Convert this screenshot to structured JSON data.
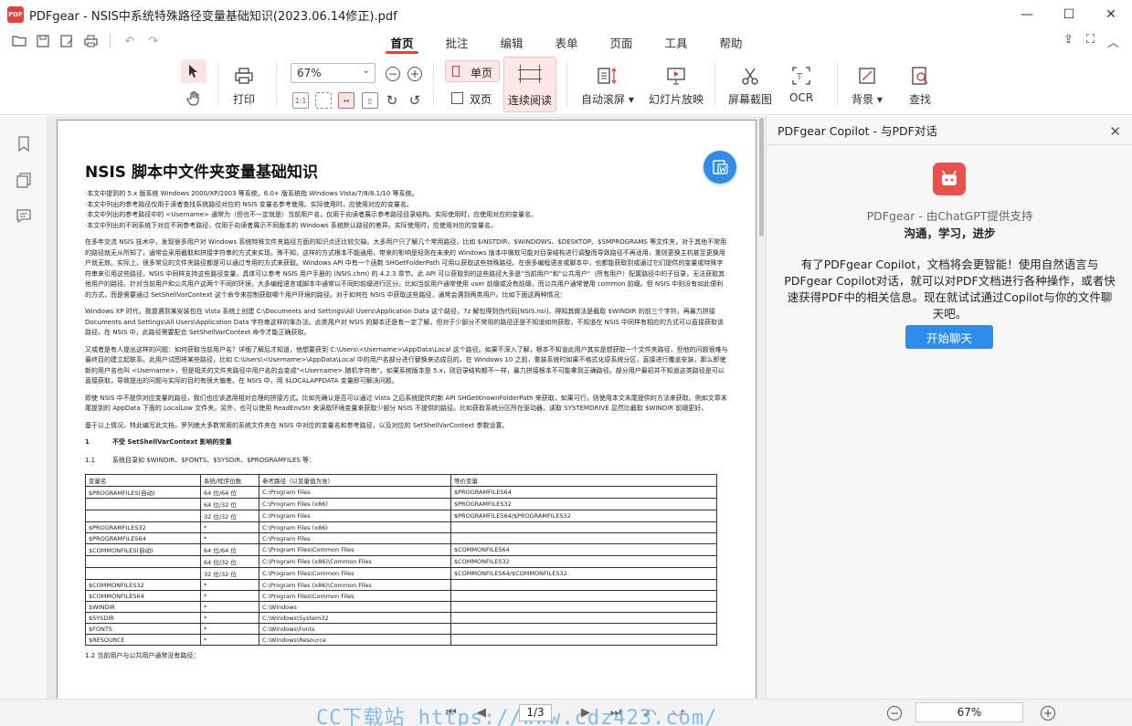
{
  "window": {
    "app_logo": "PDF",
    "title": "PDFgear - NSIS中系统特殊路径变量基础知识(2023.06.14修正).pdf",
    "minimize": "—",
    "maximize": "☐",
    "close": "✕"
  },
  "menu_tabs": [
    "首页",
    "批注",
    "编辑",
    "表单",
    "页面",
    "工具",
    "帮助"
  ],
  "ribbon": {
    "print": "打印",
    "zoom_value": "67%",
    "single_page": "单页",
    "double_page": "双页",
    "continuous": "连续阅读",
    "auto_scroll": "自动滚屏",
    "slideshow": "幻灯片放映",
    "screenshot": "屏幕截图",
    "ocr": "OCR",
    "background": "背景",
    "search": "查找",
    "small_icon_1": "1:1"
  },
  "document": {
    "title": "NSIS 脚本中文件夹变量基础知识",
    "bullets": [
      "·本文中提到的 5.x 版系统 Windows 2000/XP/2003 等系统，6.0+ 版系统指 Windows Vista/7/8/8.1/10 等系统。",
      "·本文中列出的参考路径仅用于读者查找系统路径对应的 NSIS 变量名参考使用。实际使用时，应使用对应的变量名。",
      "·本文中列出的参考路径中的 <Username> 通常为（但也不一定就是）当前用户名，仅用于向读者展示参考路径目录结构。实际使用时，应使用对应的变量名。",
      "·本文中列出的不同系统下对应不同参考路径，仅用于向读者展示不同版本的 Windows 系统默认路径的差异。实际使用时，应使用对应的变量名。"
    ],
    "paragraphs": [
      "在多年交流 NSIS 技术中，发现很多用户对 Windows 系统特殊文件夹路径方面的知识点还比较欠缺。大多用户只了解几个常用路径，比如 $INSTDIR、$WINDOWS、$DESKTOP、$SMPROGRAMS 等文件夹，对于其他不常用的路径就无从所知了，通常会采用截取和拼接字符串的方式来实现。殊不知，这样的方式根本不能通用，带来的影响是轻则在未来的 Windows 版本中微软可能对目录结构进行调整而导致路径不再适用，重则更换主机甚至更换用户就无效。实际上，很多常见的文件夹路径都是可以通过专用的方式来获取。Windows API 中有一个函数 SHGetFolderPath 可用以获取这些特殊路径。在很多编程语言或脚本中，也都能获取到或通过它们提供的变量或特殊字符串来引用这些路径，NSIS 中同样支持这些路径变量，具体可以参考 NSIS 用户手册的 (NSIS.chm) 的 4.2.3 章节。此 API 可以获取到的这些路径大多是\"当前用户\"和\"公共用户\"（所有用户）配置路径中的子目录，无法获取其他用户的路径。针对当前用户和公共用户这两个不同的环境，大多编程语言或脚本中通常以不同的前缀进行区分。比如当前用户通常使用 user 前缀或没有前缀，而公共用户通常使用 common 前缀。但 NSIS 中则没有如此便利的方式，而是需要通过 SetShellVarContext 这个命令来控制获取哪个用户环境的路径。对于如何在 NSIS 中获取这些路径，通常会遇到两类用户。比如下面这两种情况：",
      "Windows XP 时代，我曾遇到某安装包在 Vista 系统上创建 C:\\Documents and Settings\\All Users\\Application Data 这个路径，7z 解包得到伪代码[NSIS.nsi]，得知其做法是截取 $WINDIR 的前三个字符，再暴力拼接 Documents and Settings\\All Users\\Application Data 字符串这样的笨办法。此类用户对 NSIS 的脚本还是有一定了解，但对于少部分不常用的路径还是不知道如何获取，不知道在 NSIS 中同样有相应的方式可以直接获取该路径。在 NSIS 中，此路径需要配合 SetShellVarContext 命令才能正确获取。",
      "又或者是有人提出这样的问题：如何获取当前用户名？详细了解后才知道，他想要获到 C:\\Users\\<Username>\\AppData\\Local 这个路径。如果不深入了解，根本不知道此用户其实是想获取一个文件夹路径，但他的问题很难与最终目的建立起联系。此用户试图将某些路径，比如 C:\\Users\\<Username>\\AppData\\Local 中的用户名部分进行替换来达成目的。在 Windows 10 之前，重装系统时如果不格式化原系统分区，直接进行覆盖安装，那么即使新的用户名也叫 <Username>，但是相关的文件夹路径中用户名的会变成\"<Username>.随机字符串\"。如果系统版本是 5.x，则目录结构都不一样，暴力拼接根本不可能拿到正确路径。部分用户最初并不知道这类路径是可以直接获取，导致提出的问题与实际的目的有很大偏差。在 NSIS 中，用 $LOCALAPPDATA 变量即可解决问题。",
      "即使 NSIS 中不提供对应变量的路径，我们也应该选用相对合理的拼接方式。比如先确认是否可以通过 Vista 之后系统提供的新 API SHGetKnownFolderPath 来获取，如果可行，则使用本文末尾提供的方法来获取。例如文章末尾提到的 AppData 下面的 LocalLow 文件夹。另外，也可以使用 ReadEnvStr 来读取环境变量来获取少部分 NSIS 不提供的路径。比如获取系统分区所在驱动器，读取 SYSTEMDRIVE 显然比截取 $WINDIR 前缀更好。",
      "基于以上情况，特此编写此文档，罗列绝大多数常用的系统文件夹在 NSIS 中对应的变量名和参考路径，以及对应的 SetShellVarContext 参数设置。"
    ],
    "h1_num": "1",
    "h1": "不受 SetShellVarContext 影响的变量",
    "h2_num": "1.1",
    "h2": "系统目录如 $WINDIR、$FONTS、$SYSDIR、$PROGRAMFILES 等：",
    "table_header": [
      "变量名",
      "系统/程序位数",
      "参考路径（以变量值为准）",
      "等价变量"
    ],
    "table_rows": [
      [
        "$PROGRAMFILES(自动)",
        "64 位/64 位",
        "C:\\Program Files",
        "$PROGRAMFILES64"
      ],
      [
        "",
        "64 位/32 位",
        "C:\\Program Files (x86)",
        "$PROGRAMFILES32"
      ],
      [
        "",
        "32 位/32 位",
        "C:\\Program Files",
        "$PROGRAMFILES64/$PROGRAMFILES32"
      ],
      [
        "$PROGRAMFILES32",
        "*",
        "C:\\Program Files (x86)",
        ""
      ],
      [
        "$PROGRAMFILES64",
        "*",
        "C:\\Program Files",
        ""
      ],
      [
        "$COMMONFILES(自动)",
        "64 位/64 位",
        "C:\\Program Files\\Common Files",
        "$COMMONFILES64"
      ],
      [
        "",
        "64 位/32 位",
        "C:\\Program Files (x86)\\Common Files",
        "$COMMONFILES32"
      ],
      [
        "",
        "32 位/32 位",
        "C:\\Program Files\\Common Files",
        "$COMMONFILES64/$COMMONFILES32"
      ],
      [
        "$COMMONFILES32",
        "*",
        "C:\\Program Files (x86)\\Common Files",
        ""
      ],
      [
        "$COMMONFILES64",
        "*",
        "C:\\Program Files\\Common Files",
        ""
      ],
      [
        "$WINDIR",
        "*",
        "C:\\Windows",
        ""
      ],
      [
        "$SYSDIR",
        "*",
        "C:\\Windows\\System32",
        ""
      ],
      [
        "$FONTS",
        "*",
        "C:\\Windows\\Fonts",
        ""
      ],
      [
        "$RESOURCE",
        "*",
        "C:\\Windows\\Resource",
        ""
      ]
    ],
    "next_heading": "1.2    当前用户与公共用户通常没有路径："
  },
  "copilot": {
    "header": "PDFgear Copilot - 与PDF对话",
    "subtitle": "PDFgear - 由ChatGPT提供支持",
    "tagline": "沟通，学习，进步",
    "description": "有了PDFgear Copilot，文档将会更智能！使用自然语言与PDFgear Copilot对话，就可以对PDF文档进行各种操作，或者快速获得PDF中的相关信息。现在就试试通过Copilot与你的文件聊天吧。",
    "button": "开始聊天"
  },
  "bottom": {
    "page": "1/3",
    "zoom": "67%",
    "watermark": "CC下载站 https://www.cdz423.com/"
  },
  "colors": {
    "accent": "#e5403a",
    "primary_blue": "#2e8de8"
  }
}
